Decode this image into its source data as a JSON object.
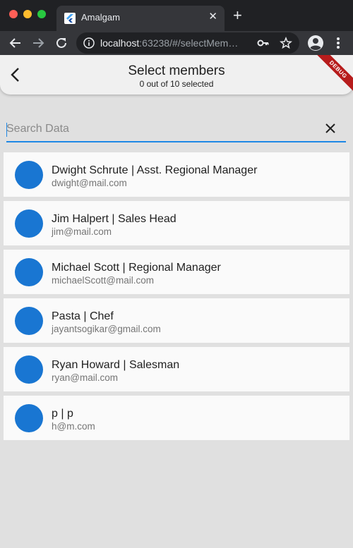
{
  "browser": {
    "tab_title": "Amalgam",
    "tab_close": "✕",
    "new_tab": "+",
    "url_host": "localhost",
    "url_rest": ":63238/#/selectMem…"
  },
  "app": {
    "title": "Select members",
    "subtitle": "0 out of 10 selected",
    "debug_banner": "DEBUG",
    "search": {
      "placeholder": "Search Data",
      "value": ""
    },
    "accent_color": "#1976d2",
    "members": [
      {
        "name": "Dwight Schrute | Asst. Regional Manager",
        "email": "dwight@mail.com"
      },
      {
        "name": "Jim Halpert | Sales Head",
        "email": "jim@mail.com"
      },
      {
        "name": "Michael Scott | Regional Manager",
        "email": "michaelScott@mail.com"
      },
      {
        "name": "Pasta | Chef",
        "email": "jayantsogikar@gmail.com"
      },
      {
        "name": "Ryan Howard | Salesman",
        "email": "ryan@mail.com"
      },
      {
        "name": "p | p",
        "email": "h@m.com"
      }
    ]
  }
}
